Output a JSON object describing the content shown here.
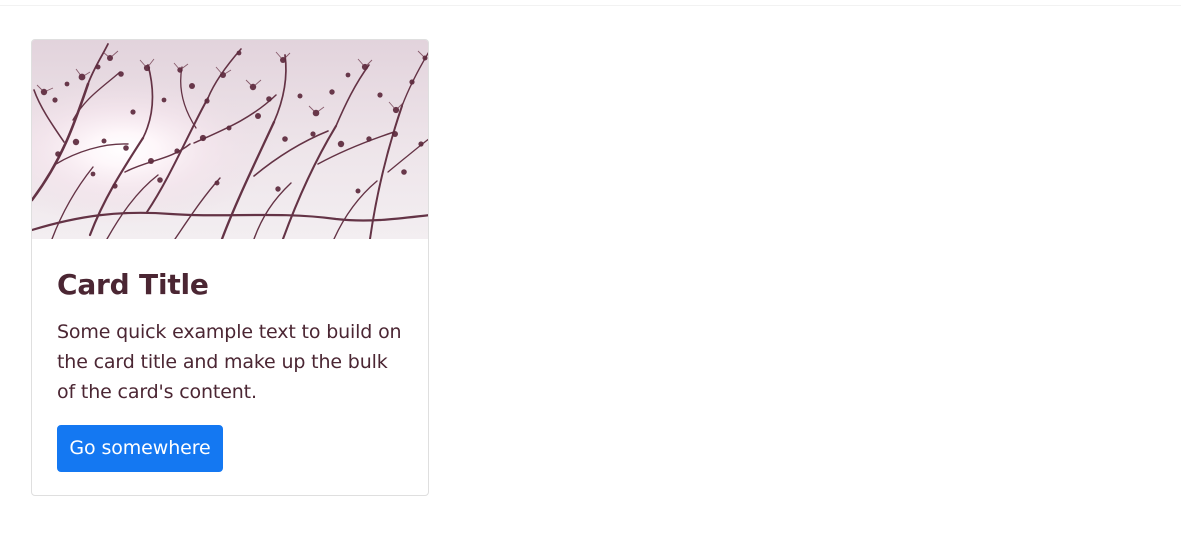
{
  "card": {
    "image_alt": "Bare branches against a bright pink sky",
    "title": "Card Title",
    "text": "Some quick example text to build on the card title and make up the bulk of the card's content.",
    "button_label": "Go somewhere"
  },
  "colors": {
    "page_background": "#ffffff",
    "card_border": "#dfdfdf",
    "text": "#4b2633",
    "button": "#1478f2",
    "button_text": "#ffffff",
    "image_sky": "#efe6ec",
    "image_branches": "#5d2a3d"
  }
}
